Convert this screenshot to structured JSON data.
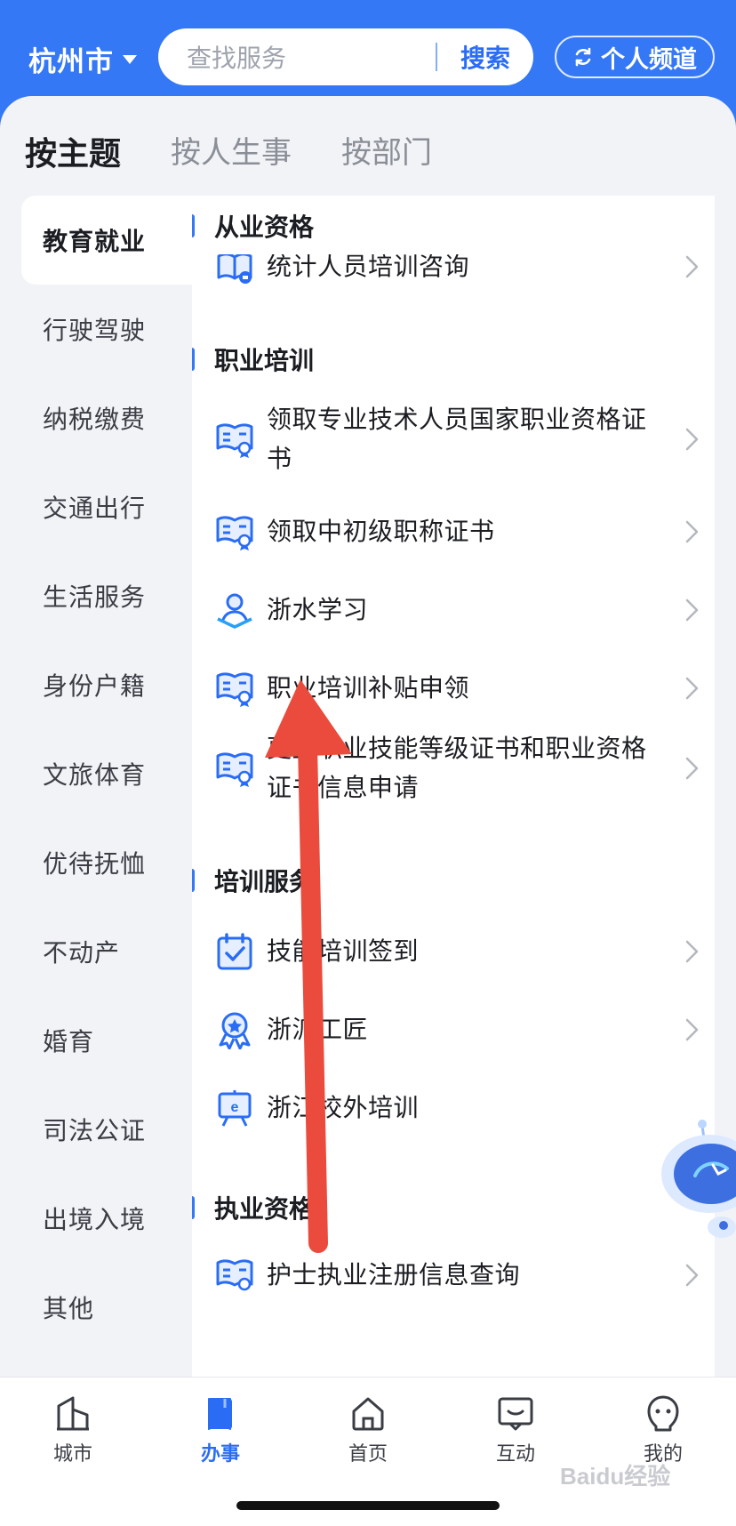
{
  "header": {
    "city": "杭州市",
    "search_placeholder": "查找服务",
    "search_button": "搜索",
    "channel_button": "个人频道",
    "accent_color": "#3478f6"
  },
  "tabs": [
    {
      "label": "按主题",
      "active": true
    },
    {
      "label": "按人生事",
      "active": false
    },
    {
      "label": "按部门",
      "active": false
    }
  ],
  "categories": [
    {
      "label": "教育就业",
      "active": true
    },
    {
      "label": "行驶驾驶"
    },
    {
      "label": "纳税缴费"
    },
    {
      "label": "交通出行"
    },
    {
      "label": "生活服务"
    },
    {
      "label": "身份户籍"
    },
    {
      "label": "文旅体育"
    },
    {
      "label": "优待抚恤"
    },
    {
      "label": "不动产"
    },
    {
      "label": "婚育"
    },
    {
      "label": "司法公证"
    },
    {
      "label": "出境入境"
    },
    {
      "label": "其他"
    }
  ],
  "sections": [
    {
      "title": "从业资格",
      "items": [
        {
          "label": "统计人员培训咨询",
          "icon": "book-icon"
        }
      ]
    },
    {
      "title": "职业培训",
      "items": [
        {
          "label": "领取专业技术人员国家职业资格证书",
          "icon": "certificate-icon"
        },
        {
          "label": "领取中初级职称证书",
          "icon": "certificate-icon"
        },
        {
          "label": "浙水学习",
          "icon": "learner-icon"
        },
        {
          "label": "职业培训补贴申领",
          "icon": "certificate-icon"
        },
        {
          "label": "更正职业技能等级证书和职业资格证书信息申请",
          "icon": "certificate-icon"
        }
      ]
    },
    {
      "title": "培训服务",
      "items": [
        {
          "label": "技能培训签到",
          "icon": "calendar-check-icon"
        },
        {
          "label": "浙派工匠",
          "icon": "medal-icon"
        },
        {
          "label": "浙江校外培训",
          "icon": "easel-icon"
        }
      ]
    },
    {
      "title": "执业资格",
      "items": [
        {
          "label": "护士执业注册信息查询",
          "icon": "certificate-icon"
        }
      ]
    }
  ],
  "bottom_nav": [
    {
      "label": "城市",
      "icon": "city-icon"
    },
    {
      "label": "办事",
      "icon": "document-icon",
      "active": true
    },
    {
      "label": "首页",
      "icon": "home-icon"
    },
    {
      "label": "互动",
      "icon": "chat-icon"
    },
    {
      "label": "我的",
      "icon": "user-icon"
    }
  ],
  "watermark": "Baidu经验"
}
